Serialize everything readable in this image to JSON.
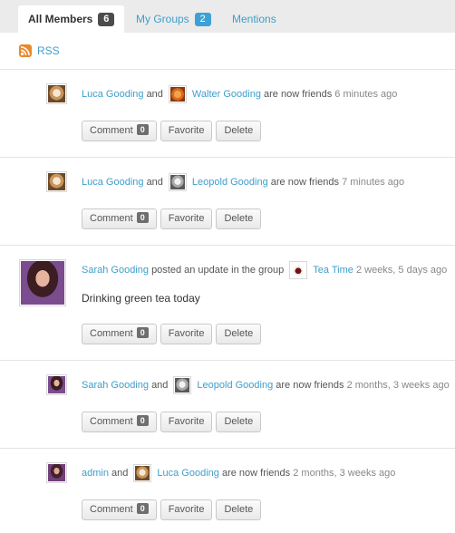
{
  "tabs": [
    {
      "label": "All Members",
      "count": "6"
    },
    {
      "label": "My Groups",
      "count": "2"
    },
    {
      "label": "Mentions"
    }
  ],
  "rss": {
    "label": "RSS",
    "icon": "rss-icon"
  },
  "buttons": {
    "comment": "Comment",
    "comment_count": "0",
    "favorite": "Favorite",
    "delete": "Delete"
  },
  "activities": [
    {
      "actor": "Luca Gooding",
      "and": "and",
      "friend": "Walter Gooding",
      "verb": "are now friends",
      "time": "6 minutes ago"
    },
    {
      "actor": "Luca Gooding",
      "and": "and",
      "friend": "Leopold Gooding",
      "verb": "are now friends",
      "time": "7 minutes ago"
    },
    {
      "actor": "Sarah Gooding",
      "verb": "posted an update in the group",
      "group": "Tea Time",
      "time": "2 weeks, 5 days ago",
      "content": "Drinking green tea today"
    },
    {
      "actor": "Sarah Gooding",
      "and": "and",
      "friend": "Leopold Gooding",
      "verb": "are now friends",
      "time": "2 months, 3 weeks ago"
    },
    {
      "actor": "admin",
      "and": "and",
      "friend": "Luca Gooding",
      "verb": "are now friends",
      "time": "2 months, 3 weeks ago"
    }
  ]
}
